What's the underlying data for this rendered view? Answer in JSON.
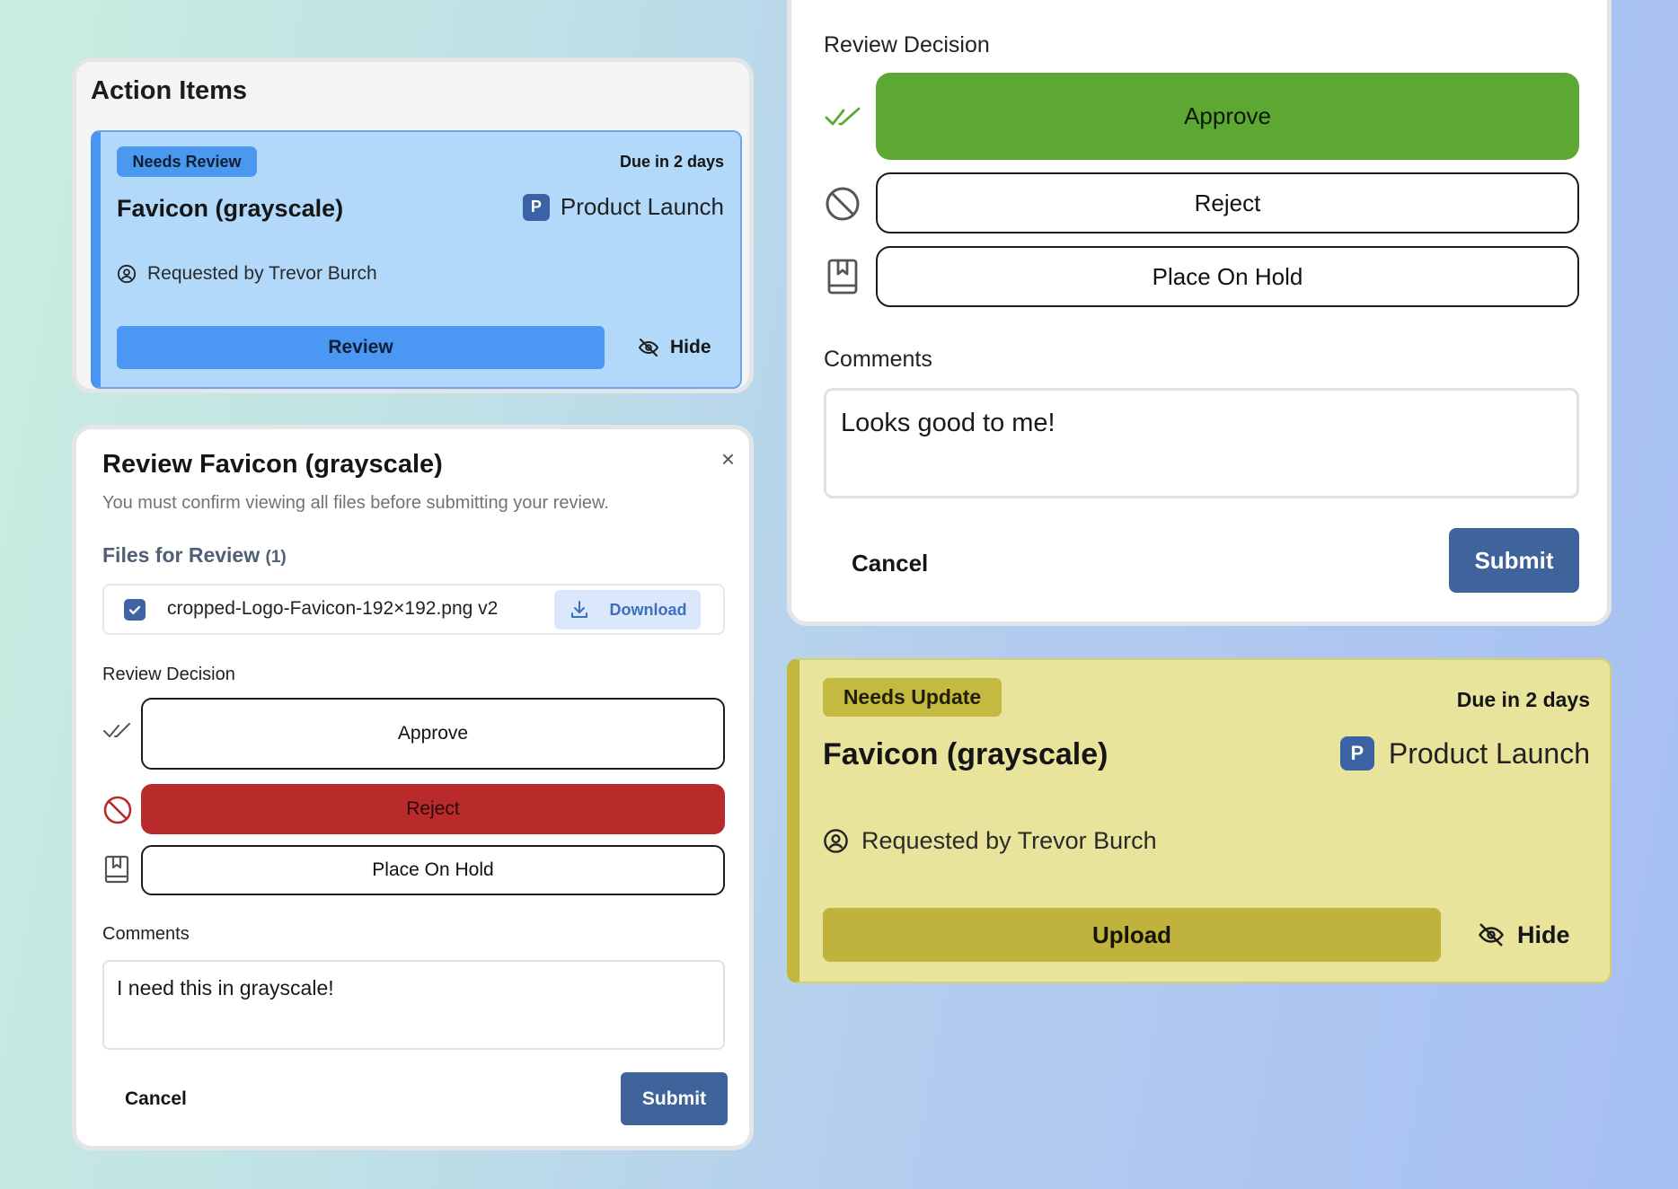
{
  "action_items": {
    "title": "Action Items",
    "review_card": {
      "status": "Needs Review",
      "due": "Due in 2 days",
      "title": "Favicon (grayscale)",
      "project_initial": "P",
      "project": "Product Launch",
      "requester": "Requested by Trevor Burch",
      "primary_action": "Review",
      "hide_label": "Hide",
      "accent_color": "#4a95f1"
    }
  },
  "review_modal_small": {
    "title": "Review Favicon (grayscale)",
    "close_glyph": "×",
    "subtitle": "You must confirm viewing all files before submitting your review.",
    "files_heading": "Files for Review",
    "files_count": "(1)",
    "file": {
      "name": "cropped-Logo-Favicon-192×192.png v2",
      "checked": true,
      "download_label": "Download"
    },
    "decision_label": "Review Decision",
    "decisions": {
      "approve": "Approve",
      "reject": "Reject",
      "hold": "Place On Hold"
    },
    "selected_decision": "Reject",
    "comments_label": "Comments",
    "comments_value": "I need this in grayscale!",
    "cancel_label": "Cancel",
    "submit_label": "Submit"
  },
  "review_modal_large": {
    "decision_label": "Review Decision",
    "decisions": {
      "approve": "Approve",
      "reject": "Reject",
      "hold": "Place On Hold"
    },
    "selected_decision": "Approve",
    "comments_label": "Comments",
    "comments_value": "Looks good to me!",
    "cancel_label": "Cancel",
    "submit_label": "Submit"
  },
  "update_card": {
    "status": "Needs Update",
    "due": "Due in 2 days",
    "title": "Favicon (grayscale)",
    "project_initial": "P",
    "project": "Product Launch",
    "requester": "Requested by Trevor Burch",
    "primary_action": "Upload",
    "hide_label": "Hide",
    "accent_color": "#c2b63e"
  },
  "colors": {
    "approve_green": "#5da833",
    "reject_red": "#b92b2b",
    "submit_blue": "#3f649b",
    "project_badge": "#3a62a5"
  },
  "icons": [
    "user-circle-icon",
    "eye-off-icon",
    "close-icon",
    "checkbox-checked-icon",
    "download-icon",
    "double-check-icon",
    "ban-icon",
    "bookmark-book-icon"
  ]
}
